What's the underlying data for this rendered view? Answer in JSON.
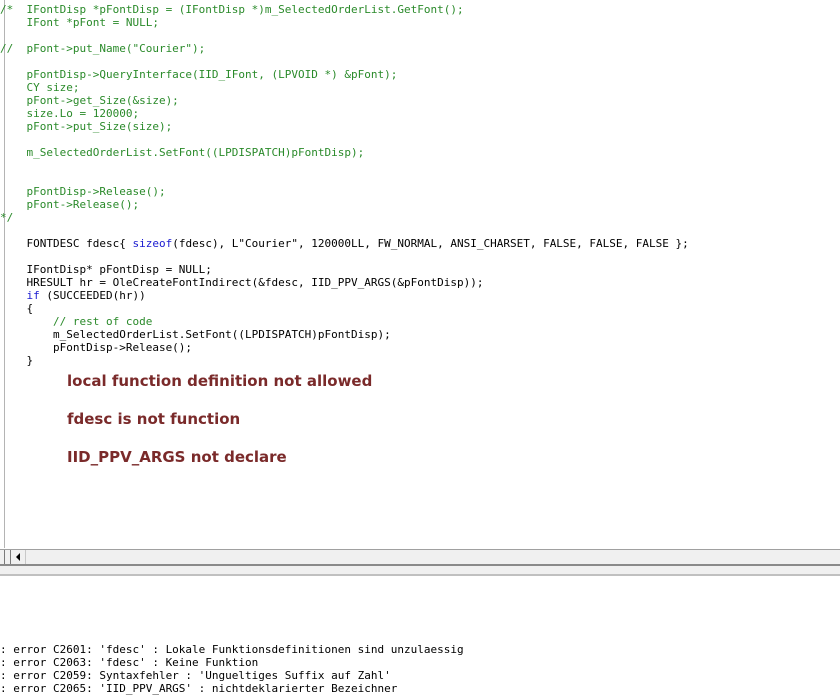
{
  "editor": {
    "code_lines": [
      {
        "segments": [
          {
            "text": "/*  IFontDisp *pFontDisp = (IFontDisp *)m_SelectedOrderList.GetFont();",
            "kind": "comment"
          }
        ]
      },
      {
        "segments": [
          {
            "text": "    IFont *pFont = NULL;",
            "kind": "comment"
          }
        ]
      },
      {
        "segments": [
          {
            "text": "",
            "kind": "normal"
          }
        ]
      },
      {
        "segments": [
          {
            "text": "//  pFont->put_Name(\"Courier\");",
            "kind": "comment"
          }
        ]
      },
      {
        "segments": [
          {
            "text": "",
            "kind": "normal"
          }
        ]
      },
      {
        "segments": [
          {
            "text": "    pFontDisp->QueryInterface(IID_IFont, (LPVOID *) &pFont);",
            "kind": "comment"
          }
        ]
      },
      {
        "segments": [
          {
            "text": "    CY size;",
            "kind": "comment"
          }
        ]
      },
      {
        "segments": [
          {
            "text": "    pFont->get_Size(&size);",
            "kind": "comment"
          }
        ]
      },
      {
        "segments": [
          {
            "text": "    size.Lo = 120000;",
            "kind": "comment"
          }
        ]
      },
      {
        "segments": [
          {
            "text": "    pFont->put_Size(size);",
            "kind": "comment"
          }
        ]
      },
      {
        "segments": [
          {
            "text": "",
            "kind": "normal"
          }
        ]
      },
      {
        "segments": [
          {
            "text": "    m_SelectedOrderList.SetFont((LPDISPATCH)pFontDisp);",
            "kind": "comment"
          }
        ]
      },
      {
        "segments": [
          {
            "text": "",
            "kind": "normal"
          }
        ]
      },
      {
        "segments": [
          {
            "text": "",
            "kind": "normal"
          }
        ]
      },
      {
        "segments": [
          {
            "text": "    pFontDisp->Release();",
            "kind": "comment"
          }
        ]
      },
      {
        "segments": [
          {
            "text": "    pFont->Release();",
            "kind": "comment"
          }
        ]
      },
      {
        "segments": [
          {
            "text": "*/",
            "kind": "comment"
          }
        ]
      },
      {
        "segments": [
          {
            "text": "",
            "kind": "normal"
          }
        ]
      },
      {
        "segments": [
          {
            "text": "    FONTDESC fdesc{ ",
            "kind": "normal"
          },
          {
            "text": "sizeof",
            "kind": "keyword"
          },
          {
            "text": "(fdesc), L\"Courier\", 120000LL, FW_NORMAL, ANSI_CHARSET, FALSE, FALSE, FALSE };",
            "kind": "normal"
          }
        ]
      },
      {
        "segments": [
          {
            "text": "",
            "kind": "normal"
          }
        ]
      },
      {
        "segments": [
          {
            "text": "    IFontDisp* pFontDisp = NULL;",
            "kind": "normal"
          }
        ]
      },
      {
        "segments": [
          {
            "text": "    HRESULT hr = OleCreateFontIndirect(&fdesc, IID_PPV_ARGS(&pFontDisp));",
            "kind": "normal"
          }
        ]
      },
      {
        "segments": [
          {
            "text": "    ",
            "kind": "normal"
          },
          {
            "text": "if",
            "kind": "keyword"
          },
          {
            "text": " (SUCCEEDED(hr))",
            "kind": "normal"
          }
        ]
      },
      {
        "segments": [
          {
            "text": "    {",
            "kind": "normal"
          }
        ]
      },
      {
        "segments": [
          {
            "text": "        // rest of code",
            "kind": "comment"
          }
        ]
      },
      {
        "segments": [
          {
            "text": "        m_SelectedOrderList.SetFont((LPDISPATCH)pFontDisp);",
            "kind": "normal"
          }
        ]
      },
      {
        "segments": [
          {
            "text": "        pFontDisp->Release();",
            "kind": "normal"
          }
        ]
      },
      {
        "segments": [
          {
            "text": "    }",
            "kind": "normal"
          }
        ]
      }
    ]
  },
  "notes": [
    "local function definition not allowed",
    "fdesc is not  function",
    "IID_PPV_ARGS not declare"
  ],
  "output": {
    "lines": [
      ": error C2601: 'fdesc' : Lokale Funktionsdefinitionen sind unzulaessig",
      ": error C2063: 'fdesc' : Keine Funktion",
      ": error C2059: Syntaxfehler : 'Ungueltiges Suffix auf Zahl'",
      ": error C2065: 'IID_PPV_ARGS' : nichtdeklarierter Bezeichner"
    ]
  },
  "colors": {
    "comment": "#2a8a2a",
    "keyword": "#1a1ad0",
    "note": "#7a2a2a"
  }
}
